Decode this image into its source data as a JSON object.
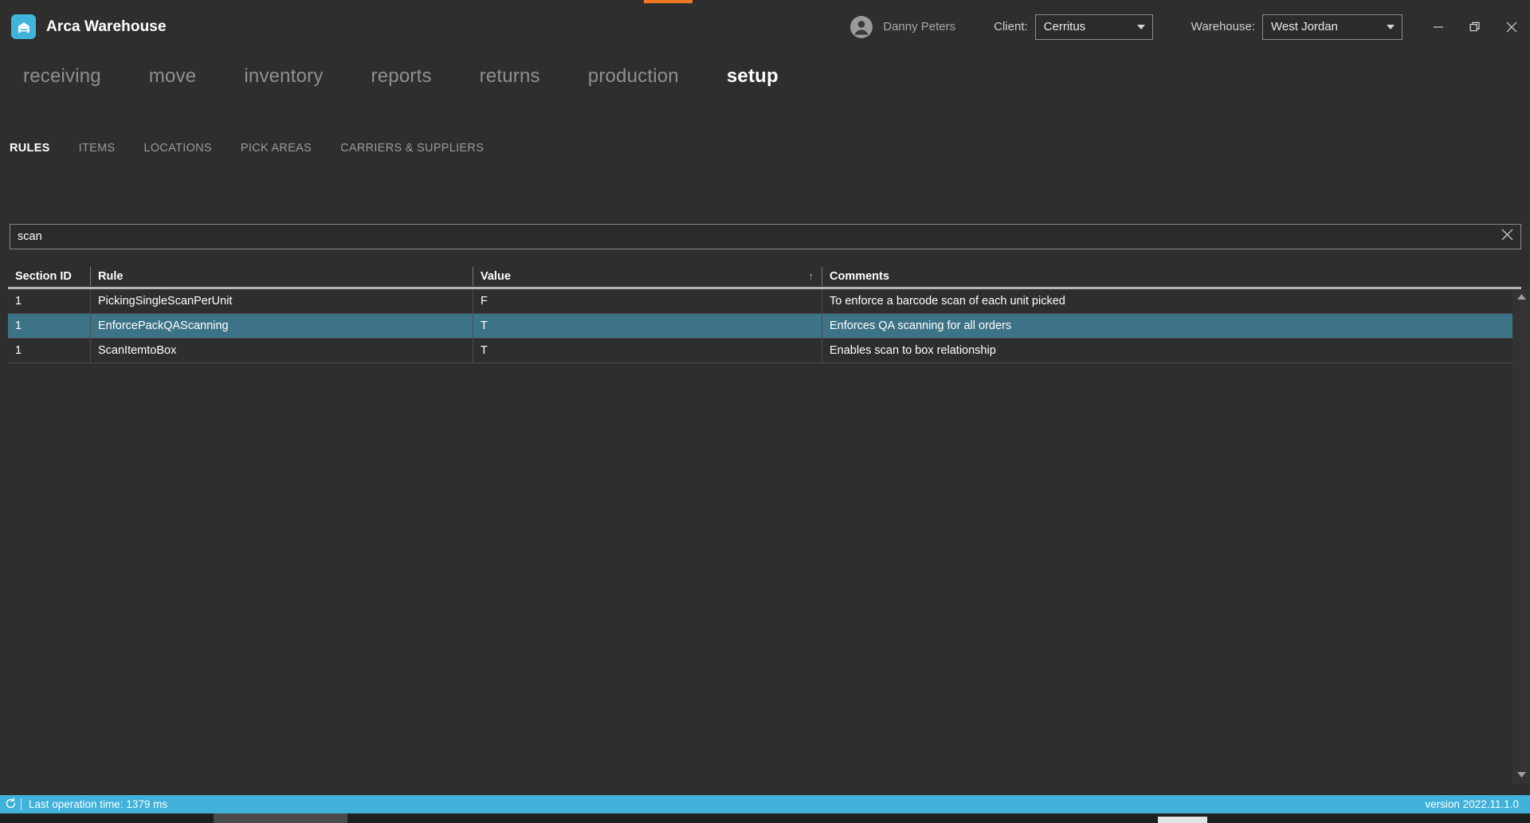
{
  "app": {
    "title": "Arca Warehouse",
    "logo_icon": "warehouse-icon",
    "accent_color": "#ef7622",
    "brand_color": "#41b4dd"
  },
  "titlebar": {
    "user": {
      "name": "Danny Peters",
      "avatar_icon": "user-avatar-icon"
    },
    "client": {
      "label": "Client:",
      "value": "Cerritus",
      "arrow_icon": "chevron-down-icon"
    },
    "warehouse": {
      "label": "Warehouse:",
      "value": "West Jordan",
      "arrow_icon": "chevron-down-icon"
    },
    "window_controls": {
      "minimize_icon": "minimize-icon",
      "restore_icon": "restore-icon",
      "close_icon": "close-icon"
    }
  },
  "main_nav": {
    "items": [
      {
        "label": "receiving",
        "active": false
      },
      {
        "label": "move",
        "active": false
      },
      {
        "label": "inventory",
        "active": false
      },
      {
        "label": "reports",
        "active": false
      },
      {
        "label": "returns",
        "active": false
      },
      {
        "label": "production",
        "active": false
      },
      {
        "label": "setup",
        "active": true
      }
    ]
  },
  "sub_nav": {
    "items": [
      {
        "label": "RULES",
        "active": true
      },
      {
        "label": "ITEMS",
        "active": false
      },
      {
        "label": "LOCATIONS",
        "active": false
      },
      {
        "label": "PICK AREAS",
        "active": false
      },
      {
        "label": "CARRIERS & SUPPLIERS",
        "active": false
      }
    ]
  },
  "search": {
    "value": "scan",
    "placeholder": "",
    "clear_icon": "close-icon"
  },
  "grid": {
    "columns": [
      {
        "label": "Section ID",
        "sorted": false
      },
      {
        "label": "Rule",
        "sorted": false
      },
      {
        "label": "Value",
        "sorted": true,
        "sort_icon": "sort-ascending-arrow",
        "sort_glyph": "↑"
      },
      {
        "label": "Comments",
        "sorted": false
      }
    ],
    "rows": [
      {
        "section_id": "1",
        "rule": "PickingSingleScanPerUnit",
        "value": "F",
        "comments": "To enforce a barcode scan of each unit picked",
        "selected": false
      },
      {
        "section_id": "1",
        "rule": "EnforcePackQAScanning",
        "value": "T",
        "comments": "Enforces QA scanning for all orders",
        "selected": true
      },
      {
        "section_id": "1",
        "rule": "ScanItemtoBox",
        "value": "T",
        "comments": "Enables scan to box relationship",
        "selected": false
      }
    ],
    "selection_color": "#3d7387"
  },
  "scrollbar": {
    "up_icon": "triangle-up-icon",
    "down_icon": "triangle-down-icon"
  },
  "status_bar": {
    "refresh_icon": "refresh-icon",
    "message": "Last operation time:  1379 ms",
    "version": "version 2022.11.1.0",
    "background_color": "#3fb1da"
  }
}
